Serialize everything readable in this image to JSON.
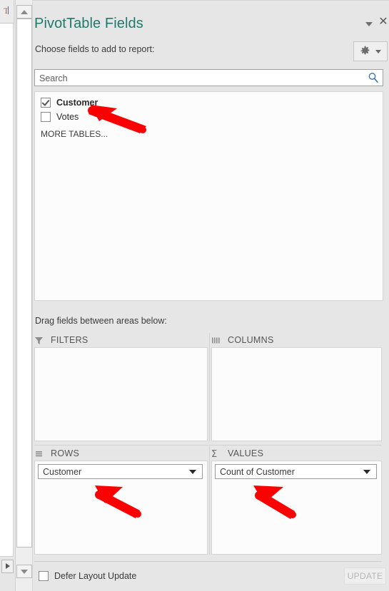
{
  "worksheet": {
    "column_letter": "T",
    "scroll_up_icon": "triangle-up-icon",
    "scroll_down_icon": "triangle-down-icon",
    "sheet_nav_icon": "triangle-right-icon"
  },
  "panel": {
    "title": "PivotTable Fields",
    "title_color": "#1f7a6c",
    "collapse_icon": "chevron-down-icon",
    "close_icon": "close-icon",
    "choose_label": "Choose fields to add to report:",
    "tools_icon": "gear-icon",
    "tools_caret_icon": "caret-down-icon"
  },
  "search": {
    "value": "",
    "placeholder": "Search",
    "icon": "search-icon",
    "icon_color": "#2e6da4"
  },
  "field_list": {
    "items": [
      {
        "label": "Customer",
        "checked": true,
        "bold": true
      },
      {
        "label": "Votes",
        "checked": false,
        "bold": false
      }
    ],
    "more_tables_label": "MORE TABLES..."
  },
  "areas": {
    "drag_label": "Drag fields between areas below:",
    "filters": {
      "label": "FILTERS",
      "icon": "funnel-icon",
      "pills": []
    },
    "columns": {
      "label": "COLUMNS",
      "icon": "columns-icon",
      "pills": []
    },
    "rows": {
      "label": "ROWS",
      "icon": "rows-icon",
      "pills": [
        {
          "label": "Customer",
          "caret_icon": "caret-down-icon"
        }
      ]
    },
    "values": {
      "label": "VALUES",
      "icon": "sigma-icon",
      "pills": [
        {
          "label": "Count of Customer",
          "caret_icon": "caret-down-icon"
        }
      ]
    }
  },
  "footer": {
    "defer_label": "Defer Layout Update",
    "defer_checked": false,
    "update_label": "UPDATE",
    "update_enabled": false
  },
  "annotations": {
    "arrow_color": "#fb0000",
    "arrows": [
      {
        "name": "arrow-to-customer-field",
        "points_to": "Customer field checkbox"
      },
      {
        "name": "arrow-to-rows-pill",
        "points_to": "Customer pill in ROWS"
      },
      {
        "name": "arrow-to-values-pill",
        "points_to": "Count of Customer pill in VALUES"
      }
    ]
  }
}
